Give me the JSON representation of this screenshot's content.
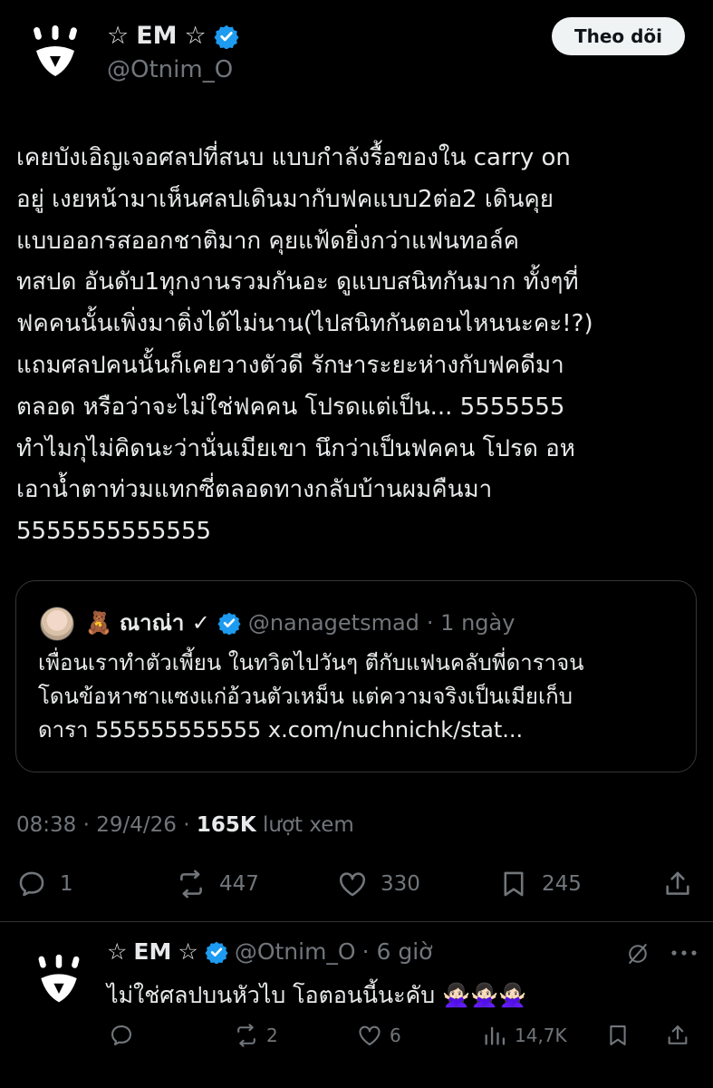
{
  "tweet": {
    "display_name": "EM",
    "name_decoration": "☆",
    "handle": "@Otnim_O",
    "follow_label": "Theo dõi",
    "text": "เคยบังเอิญเจอศลปที่สนบ แบบกำลังรื้อของใน carry on\nอยู่ เงยหน้ามาเห็นศลปเดินมากับฟคแบบ2ต่อ2 เดินคุย\nแบบออกรสออกชาติมาก คุยแฟ้ดยิ่งกว่าแฟนทอล์ค\nทสปด อันดับ1ทุกงานรวมกันอะ ดูแบบสนิทกันมาก ทั้งๆที่\nฟคคนนั้นเพิ่งมาติ่งได้ไม่นาน(ไปสนิทกันตอนไหนนะคะ!?)\nแถมศลปคนนั้นก็เคยวางตัวดี รักษาระยะห่างกับฟคดีมา\nตลอด หรือว่าจะไม่ใช่ฟคคน โปรดแต่เป็น... 5555555\nทำไมกุไม่คิดนะว่านั่นเมียเขา นึกว่าเป็นฟคคน โปรด อห\nเอาน้ำตาท่วมแทกซี่ตลอดทางกลับบ้านผมคืนมา\n5555555555555",
    "time": "08:38",
    "date": "29/4/26",
    "views": "165K",
    "views_label": "lượt xem",
    "replies": "1",
    "reposts": "447",
    "likes": "330",
    "bookmarks": "245"
  },
  "quote": {
    "emoji": "🧸",
    "name": "ณาณ่า ✓",
    "handle": "@nanagetsmad",
    "time": "· 1 ngày",
    "text": "เพื่อนเราทำตัวเพี้ยน ในทวิตไปวันๆ ตีกับแฟนคลับพี่ดาราจน\nโดนข้อหาซาแซงแก่อ้วนตัวเหม็น แต่ความจริงเป็นเมียเก็บ\nดารา 555555555555 x.com/nuchnichk/stat..."
  },
  "reply": {
    "display_name": "EM",
    "name_decoration": "☆",
    "handle": "@Otnim_O",
    "time": "· 6 giờ",
    "text": "ไม่ใช่ศลปบนหัวไบ โอตอนนี้นะคับ 🙅🏻‍♀️🙅🏻‍♀️🙅🏻‍♀️",
    "replies": "",
    "reposts": "2",
    "likes": "6",
    "views": "14,7K"
  },
  "colors": {
    "background": "#000000",
    "text": "#e7e9ea",
    "muted": "#71767b",
    "verified": "#1d9bf0",
    "border": "#2f3336"
  }
}
